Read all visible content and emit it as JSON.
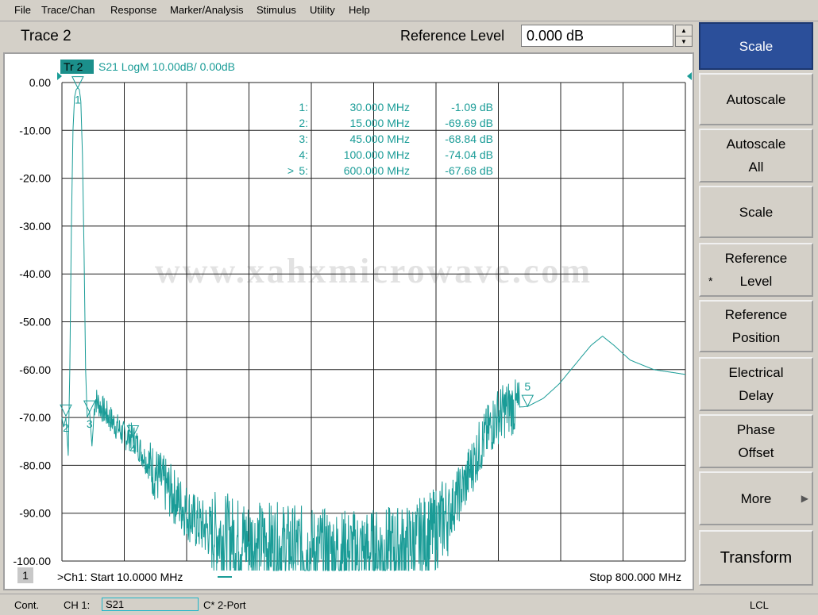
{
  "menu": [
    "File",
    "Trace/Chan",
    "Response",
    "Marker/Analysis",
    "Stimulus",
    "Utility",
    "Help"
  ],
  "header": {
    "trace_title": "Trace 2",
    "ref_label": "Reference Level",
    "ref_value": "0.000 dB"
  },
  "plot": {
    "trace_badge": "Tr 2",
    "trace_desc": "S21 LogM 10.00dB/  0.00dB",
    "y_ticks": [
      "0.00",
      "-10.00",
      "-20.00",
      "-30.00",
      "-40.00",
      "-50.00",
      "-60.00",
      "-70.00",
      "-80.00",
      "-90.00",
      "-100.00"
    ],
    "channel_num": "1",
    "start_text": ">Ch1: Start  10.0000 MHz",
    "stop_text": "Stop  800.000 MHz",
    "watermark": "www.xahxmicrowave.com",
    "colors": {
      "trace": "#1a9c97",
      "grid": "#222222",
      "accent": "#2b4f9a"
    }
  },
  "markers": [
    {
      "num": "1",
      "prefix": "",
      "freq": "30.000 MHz",
      "val": "-1.09 dB"
    },
    {
      "num": "2",
      "prefix": "",
      "freq": "15.000 MHz",
      "val": "-69.69 dB"
    },
    {
      "num": "3",
      "prefix": "",
      "freq": "45.000 MHz",
      "val": "-68.84 dB"
    },
    {
      "num": "4",
      "prefix": "",
      "freq": "100.000 MHz",
      "val": "-74.04 dB"
    },
    {
      "num": "5",
      "prefix": ">",
      "freq": "600.000 MHz",
      "val": "-67.68 dB"
    }
  ],
  "softkeys": [
    {
      "label": "Scale",
      "active": true
    },
    {
      "label": "Autoscale"
    },
    {
      "label": "Autoscale\nAll"
    },
    {
      "label": "Scale"
    },
    {
      "label": "Reference\nLevel",
      "star": true
    },
    {
      "label": "Reference\nPosition"
    },
    {
      "label": "Electrical\nDelay"
    },
    {
      "label": "Phase\nOffset"
    },
    {
      "label": "More",
      "arrow": true
    },
    {
      "label": "Transform"
    }
  ],
  "status": {
    "mode": "Cont.",
    "channel": "CH 1:",
    "param": "S21",
    "cal": "C* 2-Port",
    "remote": "LCL"
  },
  "chart_data": {
    "type": "line",
    "x_unit": "MHz",
    "y_unit": "dB",
    "xlim": [
      10,
      800
    ],
    "ylim": [
      -100,
      0
    ],
    "series": [
      {
        "name": "S21",
        "points": [
          [
            10,
            -70
          ],
          [
            12,
            -72
          ],
          [
            15,
            -70
          ],
          [
            18,
            -78
          ],
          [
            20,
            -60
          ],
          [
            22,
            -30
          ],
          [
            24,
            -10
          ],
          [
            26,
            -3
          ],
          [
            28,
            -1.5
          ],
          [
            30,
            -1.09
          ],
          [
            32,
            -1.5
          ],
          [
            34,
            -4
          ],
          [
            36,
            -15
          ],
          [
            38,
            -35
          ],
          [
            40,
            -60
          ],
          [
            42,
            -70
          ],
          [
            45,
            -68.8
          ],
          [
            48,
            -76
          ],
          [
            52,
            -66
          ],
          [
            60,
            -68
          ],
          [
            70,
            -70
          ],
          [
            80,
            -72
          ],
          [
            90,
            -74
          ],
          [
            100,
            -74
          ],
          [
            120,
            -80
          ],
          [
            140,
            -84
          ],
          [
            160,
            -88
          ],
          [
            180,
            -92
          ],
          [
            200,
            -94
          ],
          [
            250,
            -96
          ],
          [
            300,
            -97
          ],
          [
            350,
            -98
          ],
          [
            400,
            -98
          ],
          [
            450,
            -97
          ],
          [
            480,
            -94
          ],
          [
            500,
            -90
          ],
          [
            520,
            -84
          ],
          [
            540,
            -76
          ],
          [
            560,
            -70
          ],
          [
            575,
            -68
          ],
          [
            600,
            -67.7
          ],
          [
            620,
            -66
          ],
          [
            640,
            -63
          ],
          [
            660,
            -59
          ],
          [
            680,
            -55
          ],
          [
            695,
            -53
          ],
          [
            710,
            -55
          ],
          [
            730,
            -58
          ],
          [
            760,
            -60
          ],
          [
            800,
            -61
          ]
        ]
      }
    ]
  }
}
